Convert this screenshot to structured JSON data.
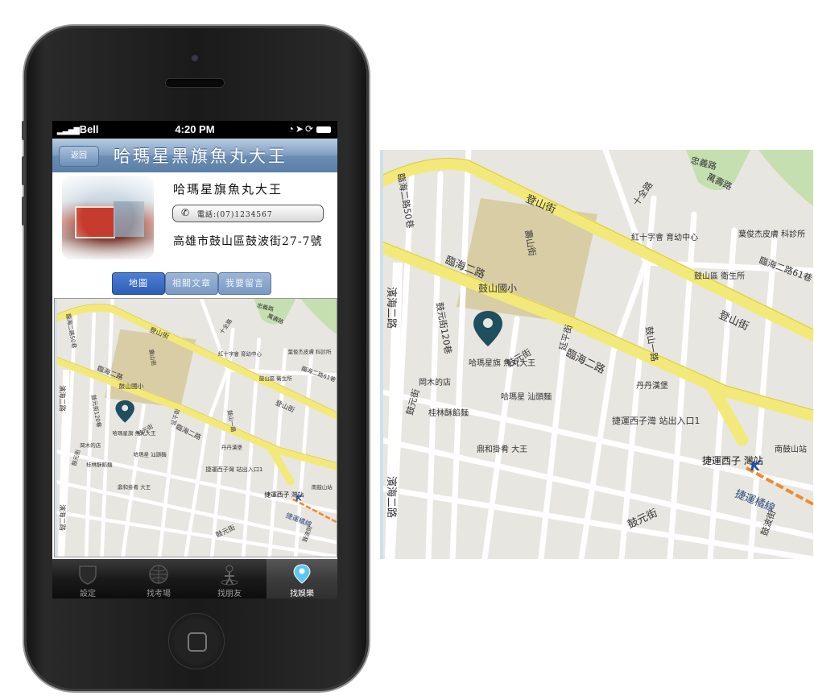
{
  "status_bar": {
    "carrier": "Bell",
    "time": "4:20 PM"
  },
  "nav": {
    "back_label": "返回",
    "title": "哈瑪星黑旗魚丸大王"
  },
  "shop": {
    "name": "哈瑪星旗魚丸大王",
    "phone_label": "電話:(07)1234567",
    "address": "高雄市鼓山區鼓波街27-7號"
  },
  "segment_tabs": [
    {
      "label": "地圖",
      "active": true
    },
    {
      "label": "相關文章",
      "active": false
    },
    {
      "label": "我要留言",
      "active": false
    }
  ],
  "tab_bar": [
    {
      "label": "設定",
      "icon": "shield-icon",
      "active": false
    },
    {
      "label": "找考場",
      "icon": "globe-icon",
      "active": false
    },
    {
      "label": "找朋友",
      "icon": "person-icon",
      "active": false
    },
    {
      "label": "找娛樂",
      "icon": "map-pin-icon",
      "active": true
    }
  ],
  "map": {
    "roads": {
      "r1": "臨海二路",
      "r2": "登山街",
      "r3": "鼓元街",
      "r4": "濱海二路",
      "r5": "鼓波街",
      "r6": "捷運橘線",
      "r7": "臨海二路61巷",
      "r8": "忠義路",
      "r9": "萬壽路",
      "r10": "十全路",
      "r11": "延平街",
      "r12": "壽山街",
      "r13": "鼓山一路",
      "r14": "臨海二路50巷",
      "r15": "鼓元街120巷"
    },
    "pois": {
      "p1": "鼓山國小",
      "p2": "紅十字會 育幼中心",
      "p3": "葉俊杰皮膚 科診所",
      "p4": "鼓山區 衛生所",
      "p5": "哈瑪星旗 魚丸大王",
      "p6": "岡木的店",
      "p7": "哈瑪星 汕頭麵",
      "p8": "桂林酥餡麵",
      "p9": "鼎和掛肴 大王",
      "p10": "丹丹漢堡",
      "p11": "捷運西子灣 站出入口1",
      "p12": "捷運西子 灣站",
      "p13": "南鼓山站"
    },
    "colors": {
      "major_road": "#f3e97a",
      "pin": "#1f4e5f",
      "school": "#d9cda6",
      "base": "#e8e6e1"
    }
  }
}
